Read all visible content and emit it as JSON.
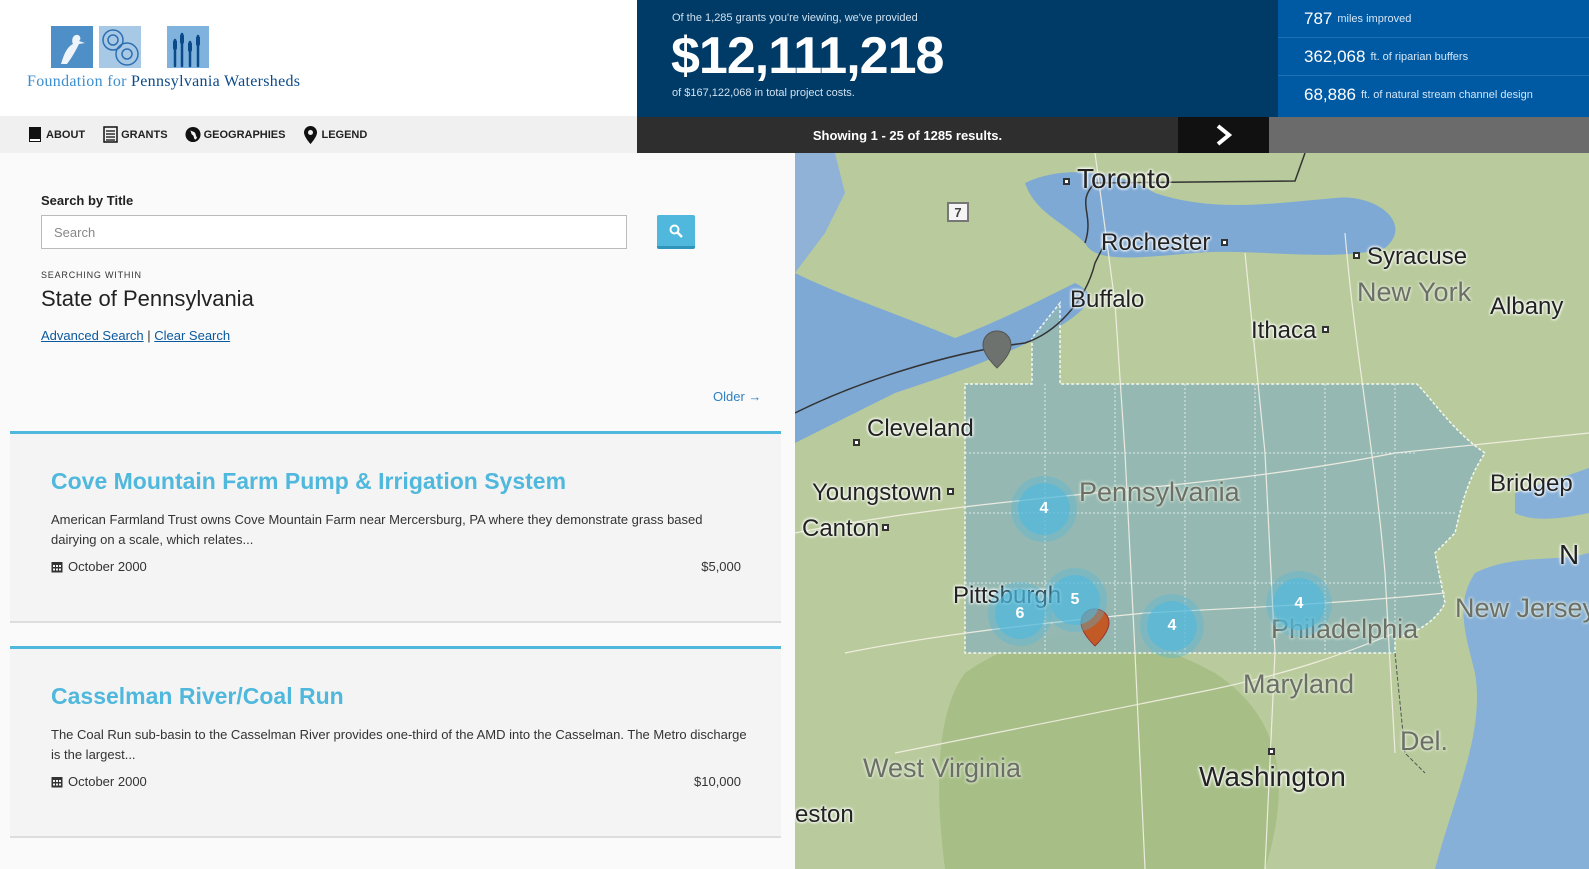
{
  "brand": {
    "name_light": "Foundation for ",
    "name_bold": "Pennsylvania Watersheds"
  },
  "stats": {
    "pre": "Of the 1,285 grants you're viewing, we've provided",
    "total": "$12,111,218",
    "post": "of $167,122,068 in total project costs.",
    "side": [
      {
        "num": "787",
        "label": "miles improved"
      },
      {
        "num": "362,068",
        "label": "ft. of riparian buffers"
      },
      {
        "num": "68,886",
        "label": "ft. of natural stream channel design"
      }
    ]
  },
  "nav": {
    "about": "ABOUT",
    "grants": "GRANTS",
    "geographies": "GEOGRAPHIES",
    "legend": "LEGEND"
  },
  "results": {
    "text": "Showing 1 - 25 of 1285 results."
  },
  "search": {
    "label": "Search by Title",
    "placeholder": "Search",
    "value": "",
    "within_label": "SEARCHING WITHIN",
    "within_value": "State of Pennsylvania",
    "advanced": "Advanced Search",
    "separator": " | ",
    "clear": "Clear Search",
    "older": "Older →"
  },
  "grants": [
    {
      "title": "Cove Mountain Farm Pump & Irrigation System",
      "description": "American Farmland Trust owns Cove Mountain Farm near Mercersburg, PA where they demonstrate grass based dairying on a scale, which relates...",
      "date": "October 2000",
      "amount": "$5,000"
    },
    {
      "title": "Casselman River/Coal Run",
      "description": "The Coal Run sub-basin to the Casselman River provides one-third of the AMD into the Casselman. The Metro discharge is the largest...",
      "date": "October 2000",
      "amount": "$10,000"
    }
  ],
  "map": {
    "places": {
      "toronto": "Toronto",
      "rochester": "Rochester",
      "syracuse": "Syracuse",
      "new_york": "New York",
      "albany": "Albany",
      "buffalo": "Buffalo",
      "ithaca": "Ithaca",
      "cleveland": "Cleveland",
      "youngstown": "Youngstown",
      "canton": "Canton",
      "pennsylvania": "Pennsylvania",
      "bridgeport": "Bridgep",
      "pittsburgh": "Pittsburgh",
      "new_jersey": "New Jersey",
      "philadelphia": "Philadelphia",
      "maryland": "Maryland",
      "del": "Del.",
      "west_virginia": "West Virginia",
      "washington": "Washington",
      "charleston": "eston",
      "n_edge": "N"
    },
    "highway_shield": "7",
    "clusters": [
      {
        "count": "4"
      },
      {
        "count": "6"
      },
      {
        "count": "5"
      },
      {
        "count": "4"
      },
      {
        "count": "4"
      }
    ]
  }
}
